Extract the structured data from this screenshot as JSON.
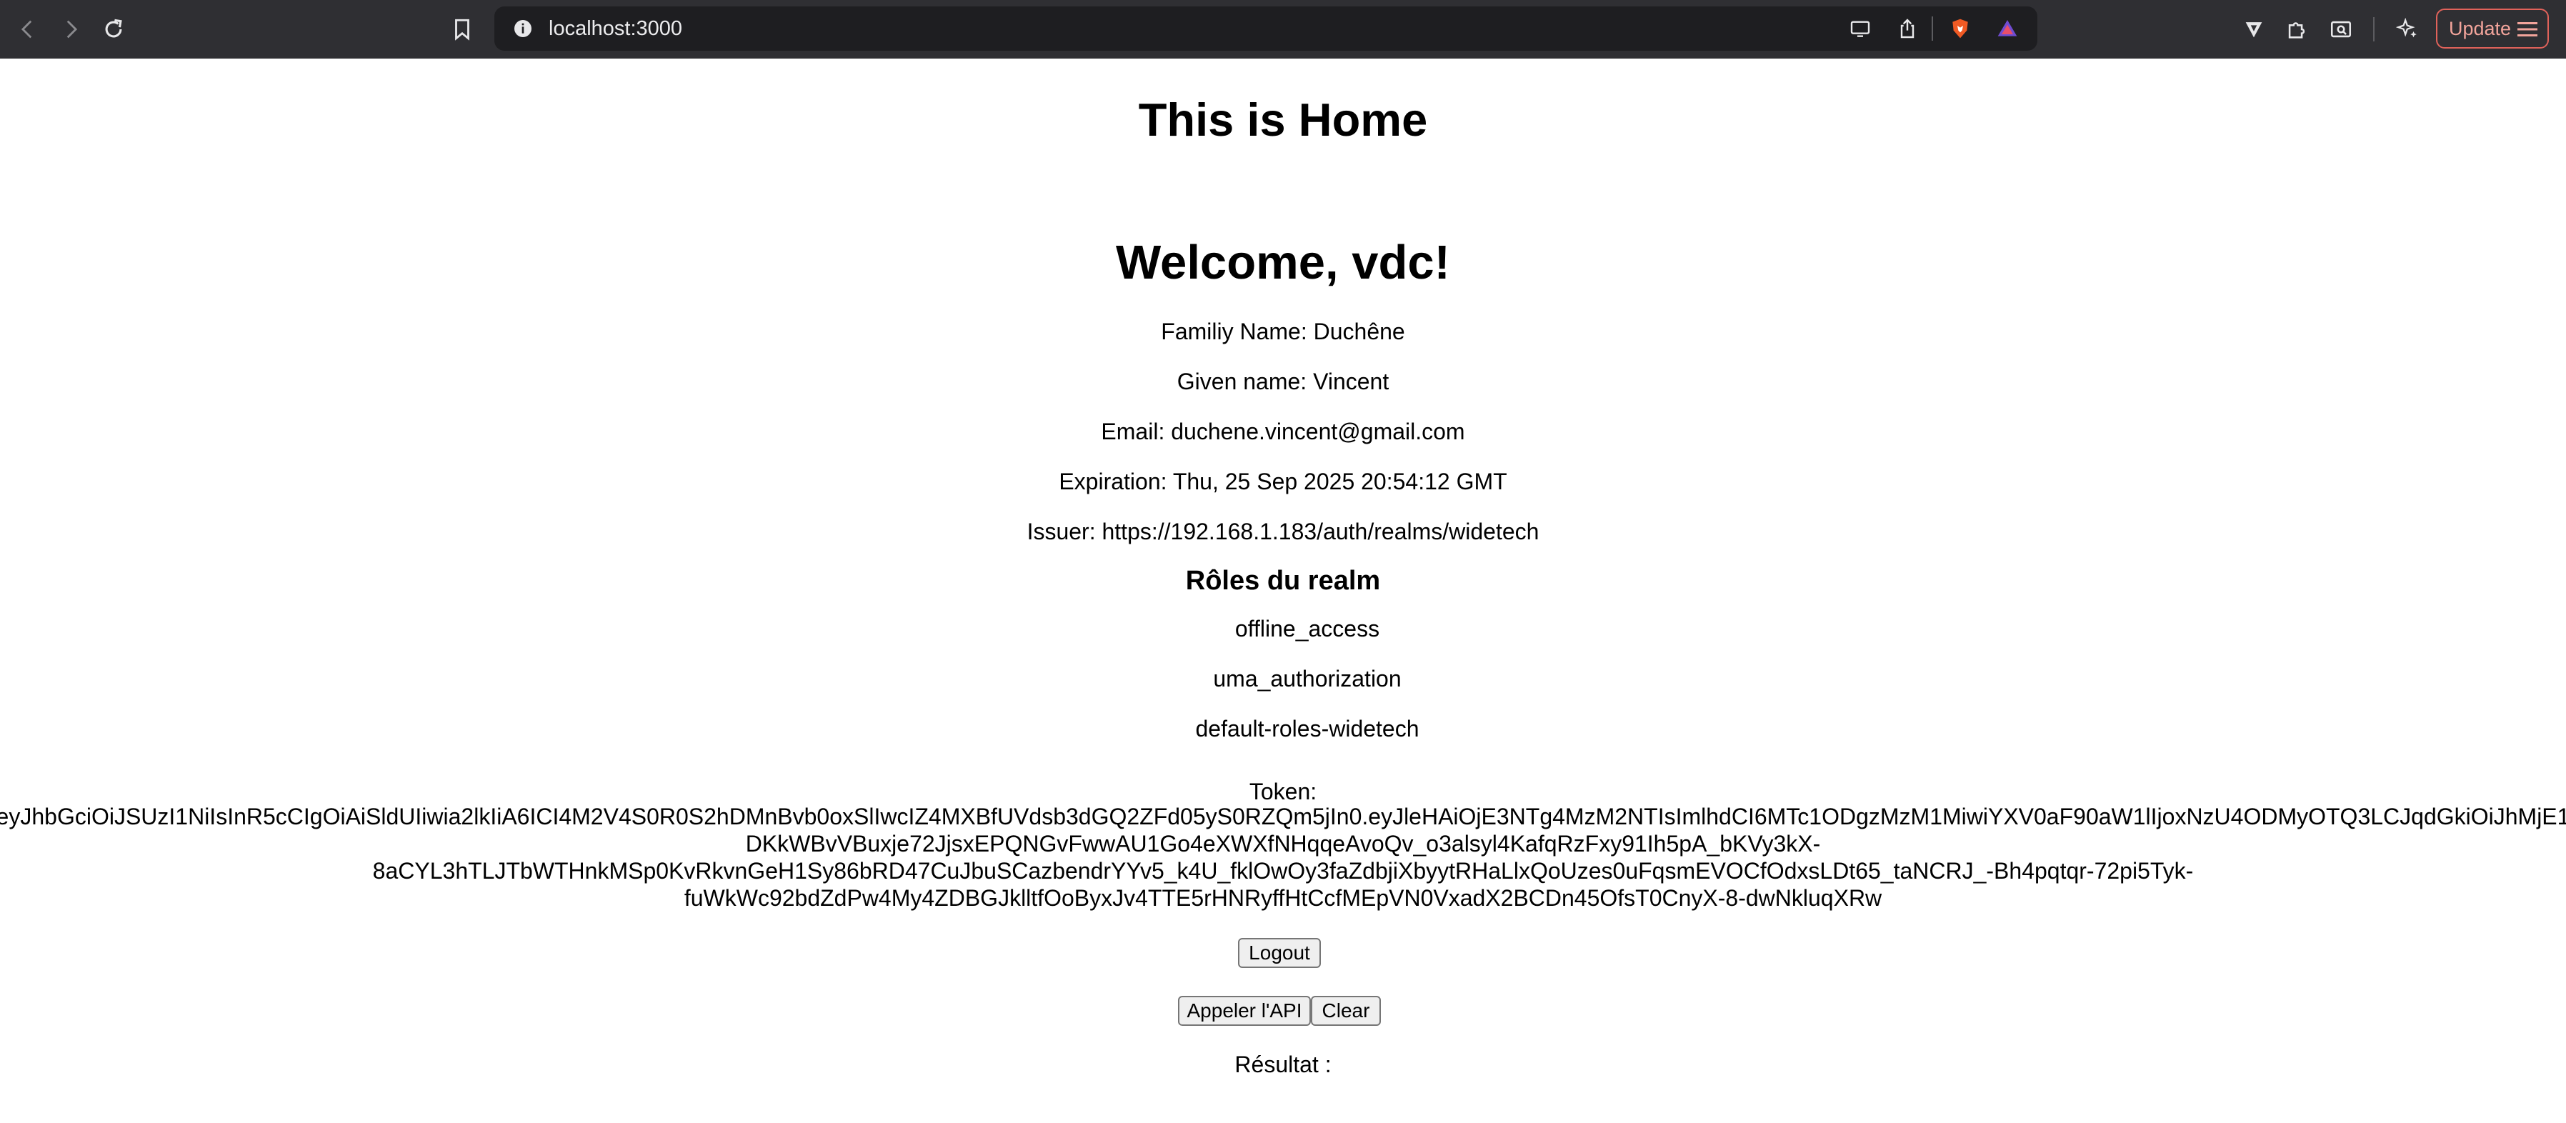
{
  "browser": {
    "url": "localhost:3000",
    "update_label": "Update",
    "icons": {
      "back": "chevron-left-icon",
      "forward": "chevron-right-icon",
      "reload": "reload-icon",
      "bookmark": "bookmark-icon",
      "site_info": "info-icon",
      "cast": "cast-icon",
      "share": "share-icon",
      "brave_shield": "brave-shield-icon",
      "rewards": "rewards-triangle-icon",
      "vpn": "vpn-icon",
      "extensions": "puzzle-icon",
      "reader": "reader-mode-icon",
      "leo": "sparkle-icon",
      "menu": "hamburger-icon"
    },
    "colors": {
      "toolbar": "#2f2f33",
      "urlbar": "#1e1e21",
      "update_border": "#e0625a"
    }
  },
  "page": {
    "title": "This is Home",
    "welcome": "Welcome, vdc!",
    "family_name": "Familiy Name: Duchêne",
    "given_name": "Given name: Vincent",
    "email": "Email: duchene.vincent@gmail.com",
    "expiration": "Expiration: Thu, 25 Sep 2025 20:54:12 GMT",
    "issuer": "Issuer: https://192.168.1.183/auth/realms/widetech",
    "roles_heading": "Rôles du realm",
    "roles": [
      "offline_access",
      "uma_authorization",
      "default-roles-widetech"
    ],
    "token_label": "Token:",
    "token_value": "eyJhbGciOiJSUzI1NiIsInR5cCIgOiAiSldUIiwia2lkIiA6ICI4M2V4S0R0S2hDMnBvb0oxSlIwcIZ4MXBfUVdsb3dGQ2ZFd05yS0RZQm5jIn0.eyJleHAiOjE3NTg4MzM2NTIsImlhdCI6MTc1ODgzMzM1MiwiYXV0aF90aW1lIjoxNzU4ODMyOTQ3LCJqdGkiOiJhMjE1\nDKkWBvVBuxje72JjsxEPQNGvFwwAU1Go4eXWXfNHqqeAvoQv_o3alsyl4KafqRzFxy91Ih5pA_bKVy3kX-\n8aCYL3hTLJTbWTHnkMSp0KvRkvnGeH1Sy86bRD47CuJbuSCazbendrYYv5_k4U_fklOwOy3faZdbjiXbyytRHaLlxQoUzes0uFqsmEVOCfOdxsLDt65_taNCRJ_-Bh4pqtqr-72pi5Tyk-\nfuWkWc92bdZdPw4My4ZDBGJklltfOoByxJv4TTE5rHNRyffHtCcfMEpVN0VxadX2BCDn45OfsT0CnyX-8-dwNkluqXRw",
    "logout_label": "Logout",
    "call_api_label": "Appeler l'API",
    "clear_label": "Clear",
    "result_label": "Résultat :"
  }
}
